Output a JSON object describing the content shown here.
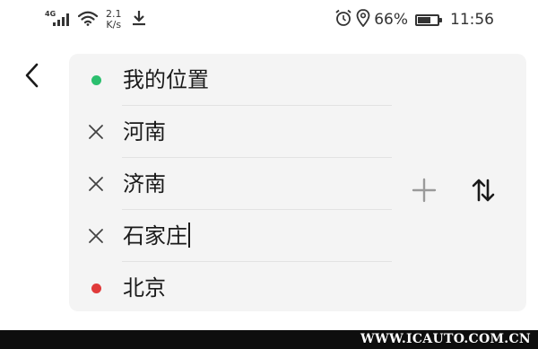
{
  "status_bar": {
    "network_type": "4G",
    "speed_value": "2.1",
    "speed_unit": "K/s",
    "battery_percent": "66%",
    "battery_level": 0.66,
    "time": "11:56",
    "icons": [
      "signal-icon",
      "wifi-icon",
      "download-icon",
      "alarm-icon",
      "location-icon",
      "battery-icon"
    ]
  },
  "route": {
    "stops": [
      {
        "label": "我的位置",
        "type": "start",
        "marker_color": "#2bbf6e"
      },
      {
        "label": "河南",
        "type": "waypoint"
      },
      {
        "label": "济南",
        "type": "waypoint"
      },
      {
        "label": "石家庄",
        "type": "waypoint",
        "focused": true
      },
      {
        "label": "北京",
        "type": "end",
        "marker_color": "#e03a3a"
      }
    ],
    "actions": [
      "add-stop",
      "swap-order"
    ]
  },
  "watermark": "WWW.ICAUTO.COM.CN"
}
